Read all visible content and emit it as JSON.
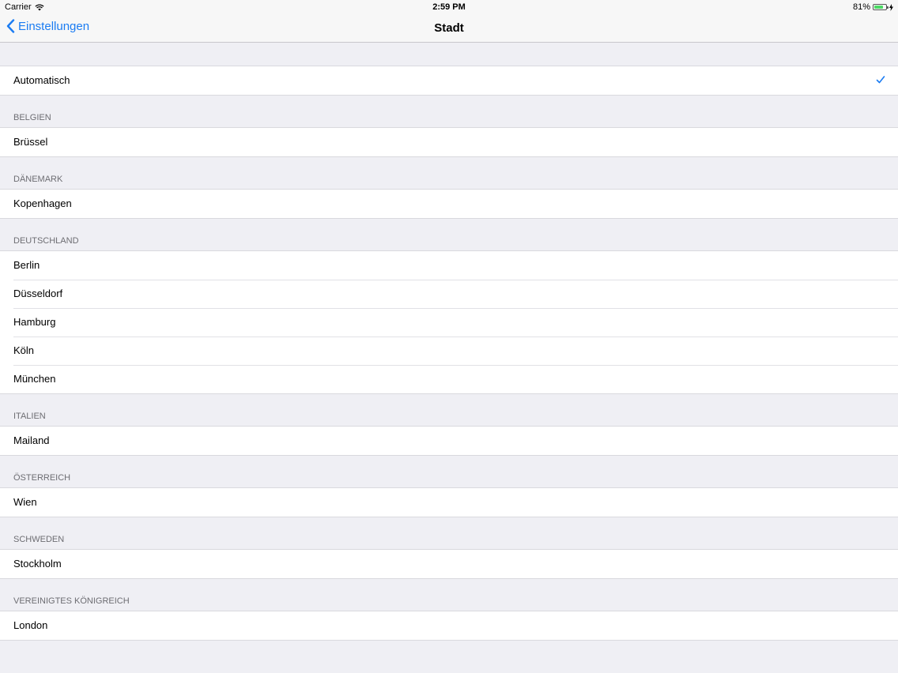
{
  "status": {
    "carrier": "Carrier",
    "time": "2:59 PM",
    "battery": "81%",
    "battery_level": 0.81
  },
  "nav": {
    "back_label": "Einstellungen",
    "title": "Stadt"
  },
  "automatic": {
    "label": "Automatisch",
    "selected": true
  },
  "groups": [
    {
      "header": "BELGIEN",
      "cities": [
        "Brüssel"
      ]
    },
    {
      "header": "DÄNEMARK",
      "cities": [
        "Kopenhagen"
      ]
    },
    {
      "header": "DEUTSCHLAND",
      "cities": [
        "Berlin",
        "Düsseldorf",
        "Hamburg",
        "Köln",
        "München"
      ]
    },
    {
      "header": "ITALIEN",
      "cities": [
        "Mailand"
      ]
    },
    {
      "header": "ÖSTERREICH",
      "cities": [
        "Wien"
      ]
    },
    {
      "header": "SCHWEDEN",
      "cities": [
        "Stockholm"
      ]
    },
    {
      "header": "VEREINIGTES KÖNIGREICH",
      "cities": [
        "London"
      ]
    }
  ],
  "colors": {
    "accent": "#1b7cf2",
    "background": "#efeff4",
    "header_text": "#6d6d72"
  }
}
